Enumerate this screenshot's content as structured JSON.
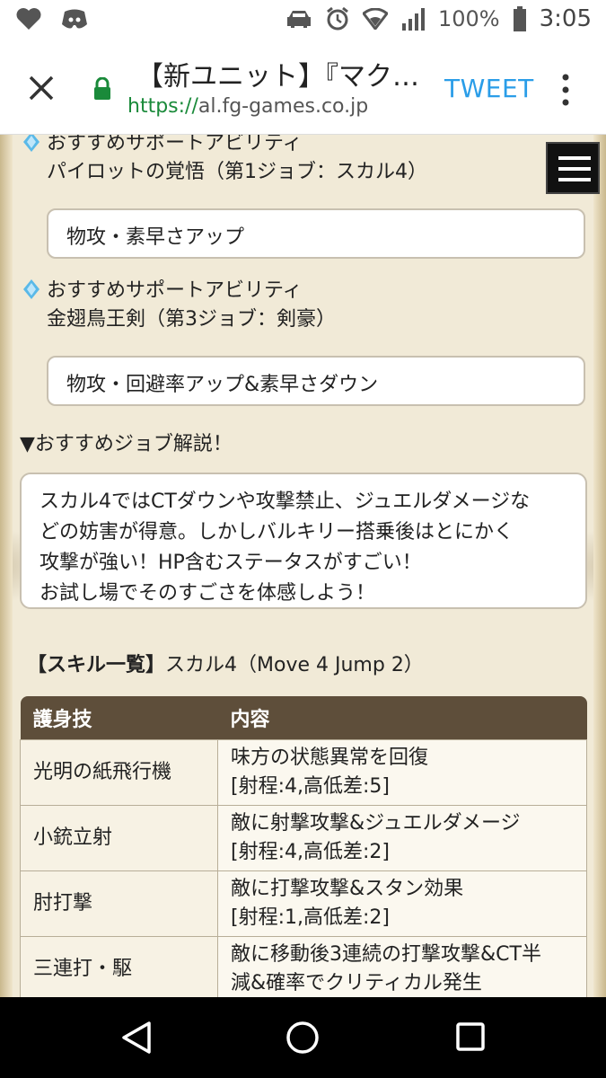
{
  "status": {
    "battery": "100%",
    "time": "3:05"
  },
  "browser": {
    "title": "【新ユニット】『マク…",
    "url_scheme": "https://",
    "url_host": "al.fg-games.co.jp",
    "tweet_label": "TWEET"
  },
  "abilities": [
    {
      "label": "おすすめサポートアビリティ",
      "name": "パイロットの覚悟（第1ジョブ：スカル4）",
      "effect": "物攻・素早さアップ"
    },
    {
      "label": "おすすめサポートアビリティ",
      "name": "金翅鳥王剣（第3ジョブ：剣豪）",
      "effect": "物攻・回避率アップ&素早さダウン"
    }
  ],
  "job_heading": "▼おすすめジョブ解説！",
  "job_description": [
    "スカル4ではCTダウンや攻撃禁止、ジュエルダメージな",
    "どの妨害が得意。しかしバルキリー搭乗後はとにかく",
    "攻撃が強い！HP含むステータスがすごい！",
    "お試し場でそのすごさを体感しよう！"
  ],
  "skill_list": {
    "bracket_title": "【スキル一覧】",
    "subtitle": "スカル4（Move 4 Jump 2）"
  },
  "skills_table": {
    "headers": [
      "護身技",
      "内容"
    ],
    "rows": [
      {
        "name": "光明の紙飛行機",
        "content": [
          "味方の状態異常を回復",
          "[射程:4,高低差:5]"
        ]
      },
      {
        "name": "小銃立射",
        "content": [
          "敵に射撃攻撃&ジュエルダメージ",
          "[射程:4,高低差:2]"
        ]
      },
      {
        "name": "肘打撃",
        "content": [
          "敵に打撃攻撃&スタン効果",
          "[射程:1,高低差:2]"
        ]
      },
      {
        "name": "三連打・駆",
        "content": [
          "敵に移動後3連続の打撃攻撃&CT半",
          "減&確率でクリティカル発生"
        ]
      }
    ]
  }
}
